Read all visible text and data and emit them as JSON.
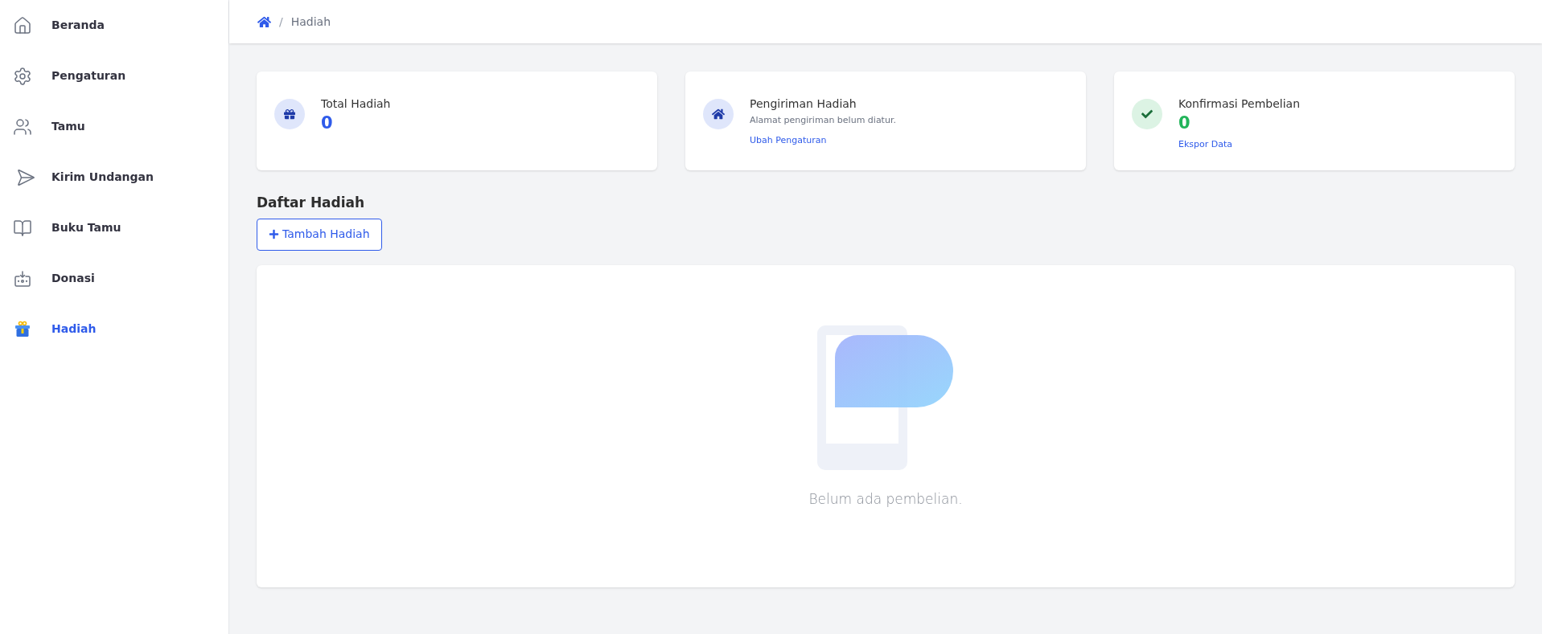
{
  "sidebar": {
    "items": [
      {
        "label": "Beranda",
        "selected": false
      },
      {
        "label": "Pengaturan",
        "selected": false
      },
      {
        "label": "Tamu",
        "selected": false
      },
      {
        "label": "Kirim Undangan",
        "selected": false
      },
      {
        "label": "Buku Tamu",
        "selected": false
      },
      {
        "label": "Donasi",
        "selected": false
      },
      {
        "label": "Hadiah",
        "selected": true
      }
    ]
  },
  "breadcrumb": {
    "separator": "/",
    "current": "Hadiah"
  },
  "cards": [
    {
      "kind": "count",
      "title": "Total Hadiah",
      "value": "0",
      "color": "#2f5bea"
    },
    {
      "kind": "note",
      "title": "Pengiriman Hadiah",
      "description": "Alamat pengiriman belum diatur.",
      "link": "Ubah Pengaturan"
    },
    {
      "kind": "count",
      "title": "Konfirmasi Pembelian",
      "value": "0",
      "color": "#22b45a",
      "link": "Ekspor Data"
    }
  ],
  "section": {
    "title": "Daftar Hadiah",
    "add_button": "Tambah Hadiah",
    "empty_message": "Belum ada pembelian."
  }
}
